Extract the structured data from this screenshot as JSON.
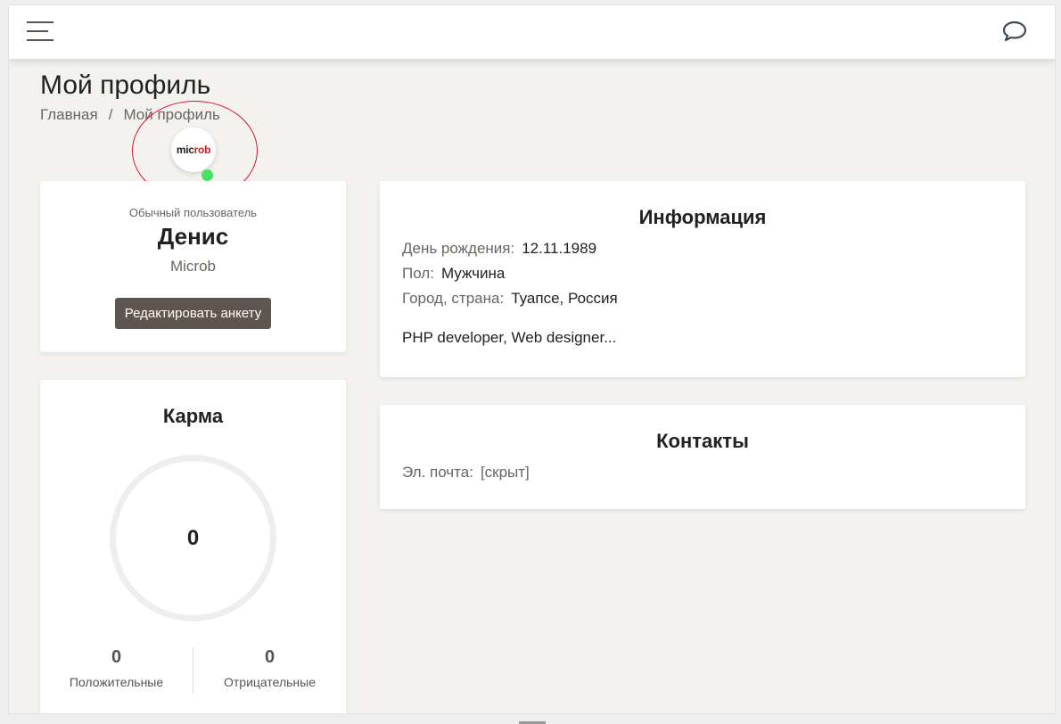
{
  "header": {
    "menu_icon": "hamburger-icon",
    "chat_icon": "chat-bubble-icon"
  },
  "page_title": "Мой профиль",
  "breadcrumb": {
    "home": "Главная",
    "separator": "/",
    "current": "Мой профиль"
  },
  "profile": {
    "avatar_text_black": "mic",
    "avatar_text_red": "rob",
    "online": true,
    "online_color": "#4ae163",
    "role": "Обычный пользователь",
    "name": "Денис",
    "nickname": "Microb",
    "edit_label": "Редактировать анкету"
  },
  "karma": {
    "title": "Карма",
    "value": "0",
    "positive": "0",
    "positive_label": "Положительные",
    "negative": "0",
    "negative_label": "Отрицательные"
  },
  "info": {
    "title": "Информация",
    "fields": [
      {
        "label": "День рождения:",
        "value": "12.11.1989"
      },
      {
        "label": "Пол:",
        "value": "Мужчина"
      },
      {
        "label": "Город, страна:",
        "value": "Туапсе, Россия"
      }
    ],
    "about": "PHP developer, Web designer..."
  },
  "contacts": {
    "title": "Контакты",
    "email_label": "Эл. почта:",
    "email_value": "[скрыт]"
  }
}
